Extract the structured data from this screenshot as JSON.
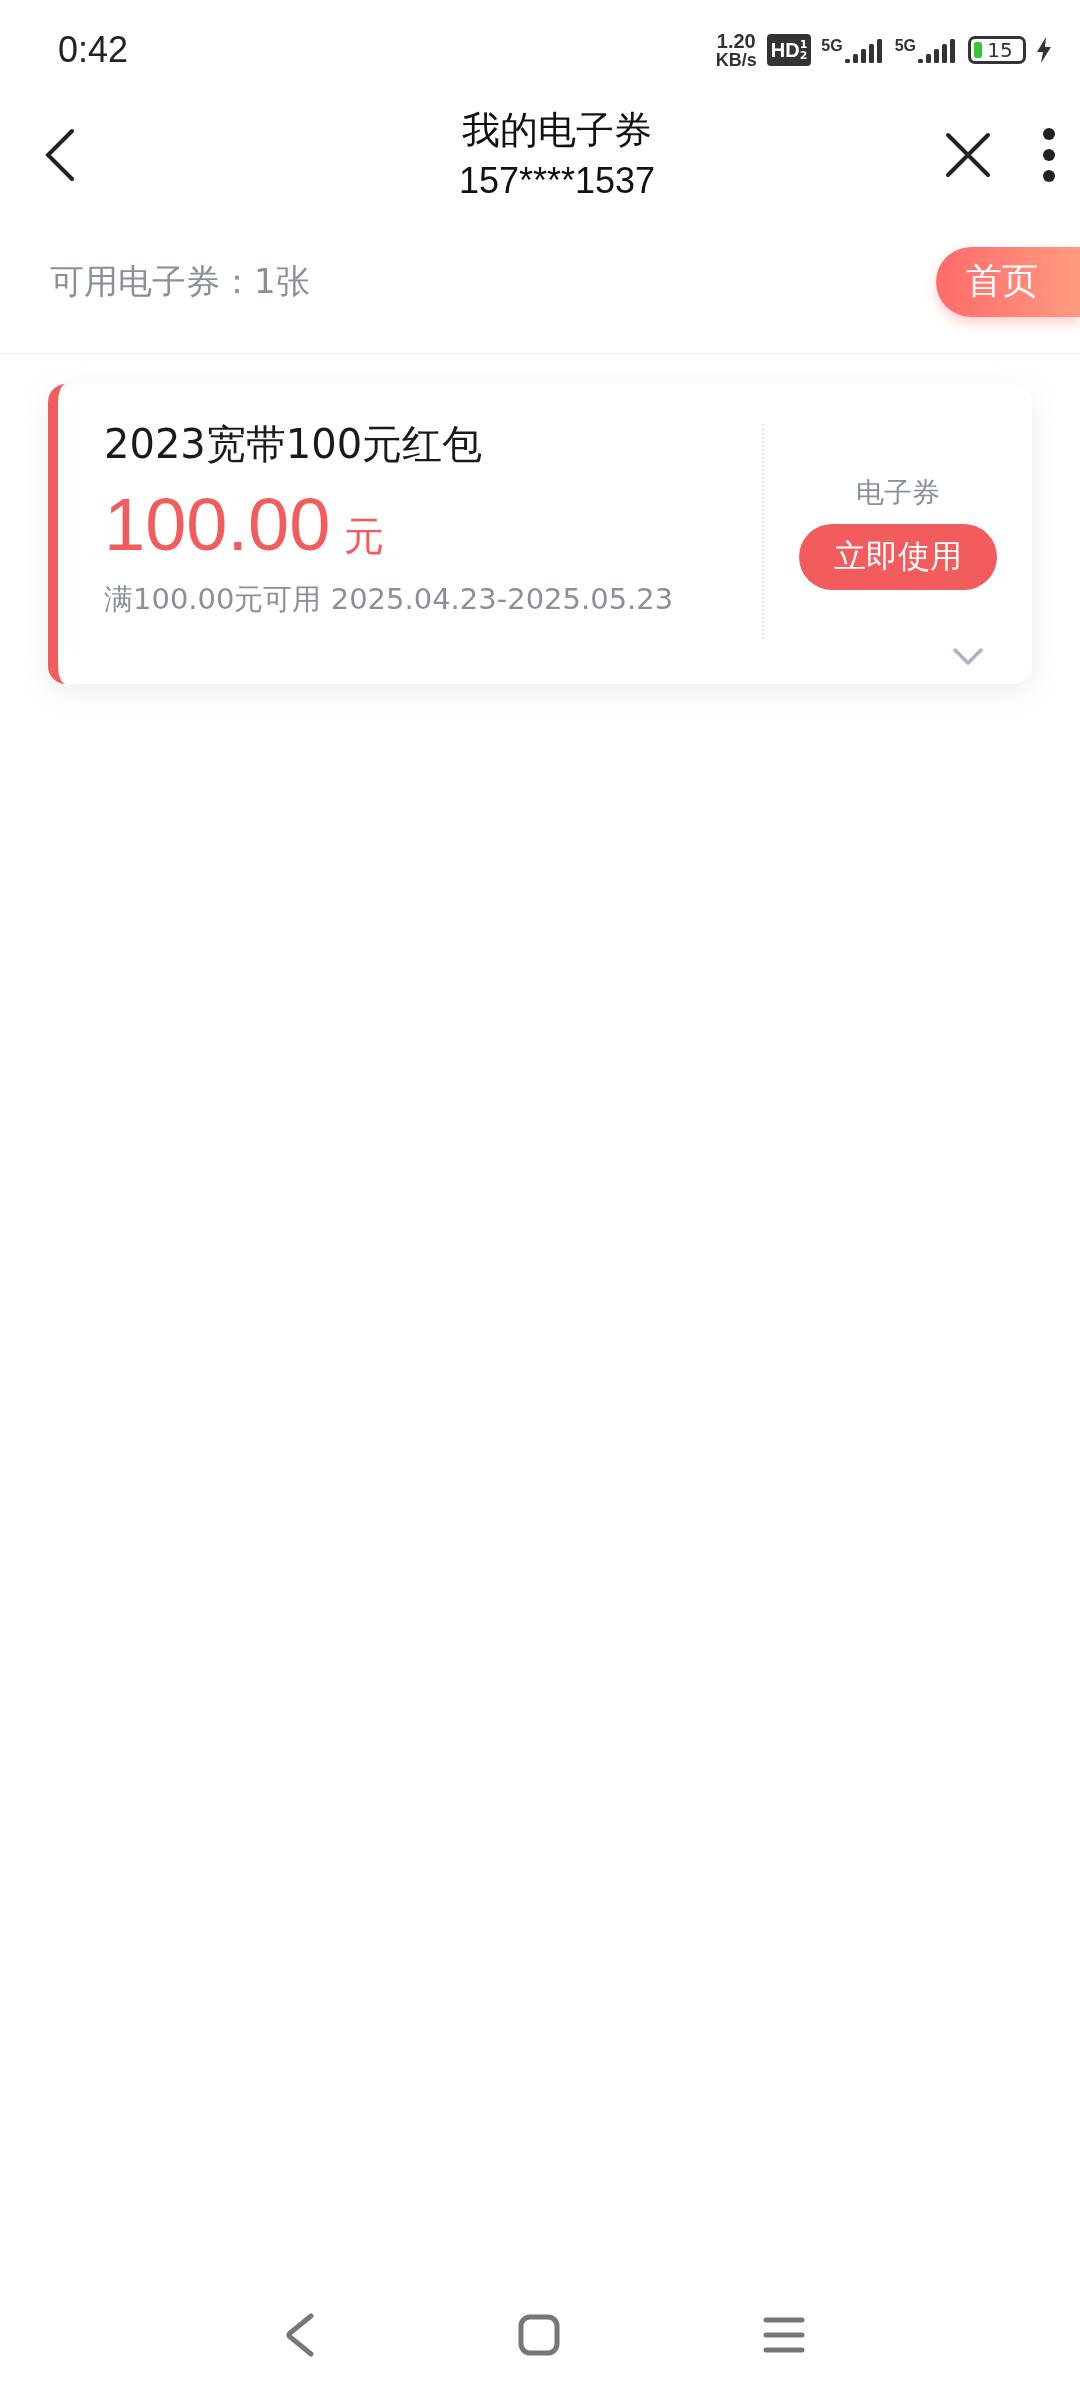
{
  "status_bar": {
    "time": "0:42",
    "speed_value": "1.20",
    "speed_unit": "KB/s",
    "hd": "HD",
    "hd_marks": [
      "1",
      "2"
    ],
    "networks": [
      {
        "label": "5G"
      },
      {
        "label": "5G"
      }
    ],
    "battery": "15",
    "charging": true
  },
  "header": {
    "title": "我的电子券",
    "subtitle": "157****1537"
  },
  "summary": {
    "text": "可用电子券：1张",
    "home_button": "首页"
  },
  "coupons": [
    {
      "title": "2023宽带100元红包",
      "amount": "100.00",
      "unit": "元",
      "condition": "满100.00元可用 2025.04.23-2025.05.23",
      "type": "电子券",
      "action": "立即使用",
      "expanded": false
    }
  ]
}
